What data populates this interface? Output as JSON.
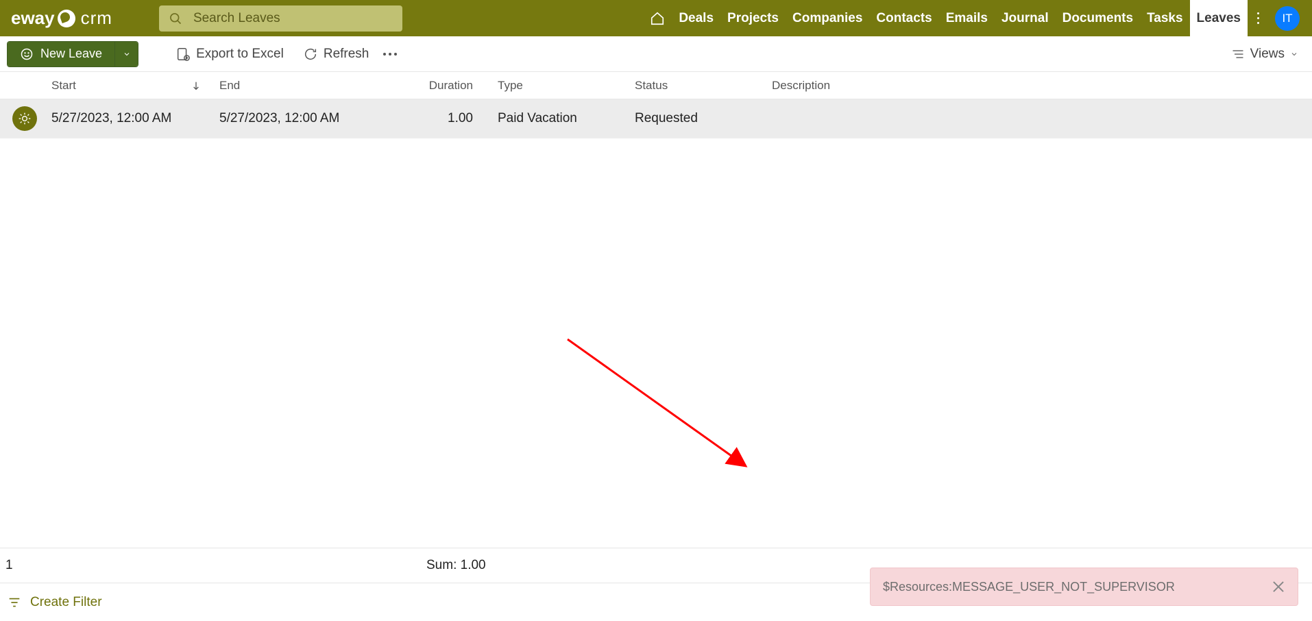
{
  "logo": {
    "part1": "eway",
    "part2": "crm"
  },
  "search": {
    "placeholder": "Search Leaves"
  },
  "nav": {
    "items": [
      "Deals",
      "Projects",
      "Companies",
      "Contacts",
      "Emails",
      "Journal",
      "Documents",
      "Tasks",
      "Leaves"
    ],
    "active": "Leaves"
  },
  "avatar": {
    "initials": "IT"
  },
  "toolbar": {
    "new_label": "New Leave",
    "export_label": "Export to Excel",
    "refresh_label": "Refresh",
    "views_label": "Views"
  },
  "columns": {
    "start": "Start",
    "end": "End",
    "duration": "Duration",
    "type": "Type",
    "status": "Status",
    "description": "Description"
  },
  "rows": [
    {
      "start": "5/27/2023, 12:00 AM",
      "end": "5/27/2023, 12:00 AM",
      "duration": "1.00",
      "type": "Paid Vacation",
      "status": "Requested",
      "description": ""
    }
  ],
  "summary": {
    "count": "1",
    "sum": "Sum: 1.00"
  },
  "filter": {
    "create": "Create Filter"
  },
  "toast": {
    "message": "$Resources:MESSAGE_USER_NOT_SUPERVISOR"
  }
}
